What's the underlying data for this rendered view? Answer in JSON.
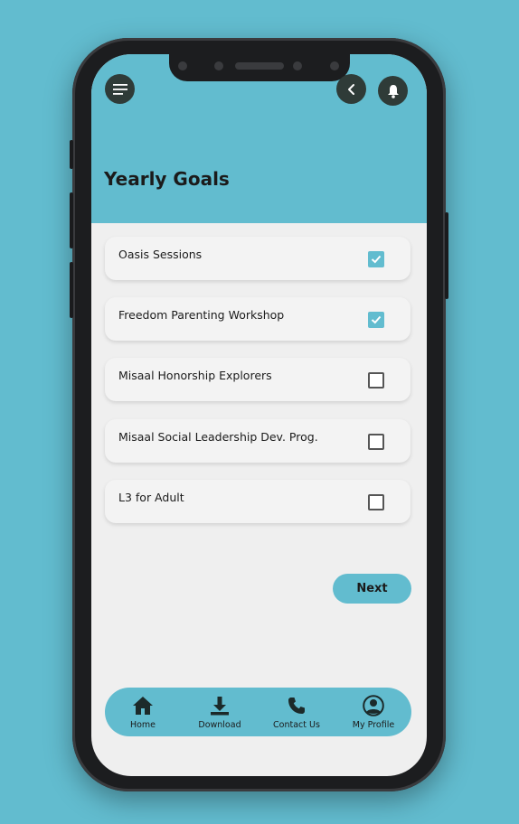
{
  "header": {
    "title": "Yearly Goals"
  },
  "icons": {
    "menu": "menu-icon",
    "back": "chevron-left-icon",
    "notifications": "bell-icon"
  },
  "goals": [
    {
      "label": "Oasis Sessions",
      "checked": true
    },
    {
      "label": "Freedom Parenting Workshop",
      "checked": true
    },
    {
      "label": "Misaal Honorship Explorers",
      "checked": false
    },
    {
      "label": "Misaal Social Leadership Dev. Prog.",
      "checked": false
    },
    {
      "label": "L3 for Adult",
      "checked": false
    }
  ],
  "actions": {
    "next_label": "Next"
  },
  "bottom_nav": {
    "items": [
      {
        "label": "Home",
        "icon": "home-icon"
      },
      {
        "label": "Download",
        "icon": "download-icon"
      },
      {
        "label": "Contact Us",
        "icon": "phone-icon"
      },
      {
        "label": "My Profile",
        "icon": "profile-icon"
      }
    ]
  },
  "colors": {
    "accent": "#62bccf",
    "dark_button": "#2f3b38",
    "background": "#efefef"
  }
}
